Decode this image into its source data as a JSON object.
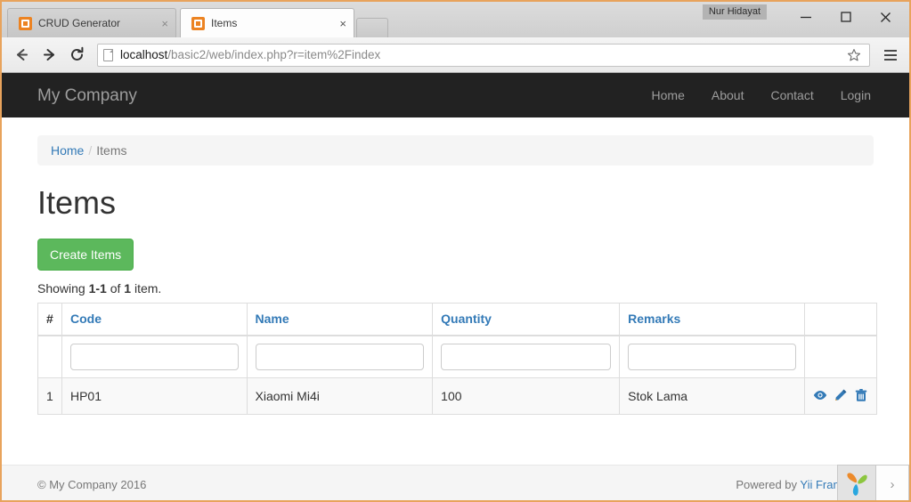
{
  "browser": {
    "user_tag": "Nur Hidayat",
    "tabs": [
      {
        "title": "CRUD Generator",
        "active": false,
        "favicon": "gii-icon",
        "close": "×"
      },
      {
        "title": "Items",
        "active": true,
        "favicon": "gii-icon",
        "close": "×"
      }
    ],
    "new_tab_label": "",
    "window_controls": {
      "minimize": "—",
      "maximize": "☐",
      "close": "✕"
    },
    "nav": {
      "back": "←",
      "forward": "→",
      "reload": "⟳"
    },
    "omnibox": {
      "url_host": "localhost",
      "url_rest": "/basic2/web/index.php?r=item%2Findex",
      "star": "☆"
    }
  },
  "site": {
    "brand": "My Company",
    "nav_links": [
      {
        "label": "Home"
      },
      {
        "label": "About"
      },
      {
        "label": "Contact"
      },
      {
        "label": "Login"
      }
    ],
    "breadcrumb": {
      "home": "Home",
      "separator": "/",
      "current": "Items"
    },
    "page_title": "Items",
    "create_button": "Create Items",
    "summary": {
      "prefix": "Showing ",
      "range": "1-1",
      "middle": " of ",
      "total": "1",
      "suffix": " item."
    },
    "grid": {
      "columns": [
        {
          "label": "#",
          "sortable": false
        },
        {
          "label": "Code",
          "sortable": true
        },
        {
          "label": "Name",
          "sortable": true
        },
        {
          "label": "Quantity",
          "sortable": true
        },
        {
          "label": "Remarks",
          "sortable": true
        },
        {
          "label": "",
          "sortable": false
        }
      ],
      "filters": [
        {
          "name": "code",
          "value": "",
          "placeholder": ""
        },
        {
          "name": "name",
          "value": "",
          "placeholder": ""
        },
        {
          "name": "quantity",
          "value": "",
          "placeholder": ""
        },
        {
          "name": "remarks",
          "value": "",
          "placeholder": ""
        }
      ],
      "rows": [
        {
          "index": "1",
          "code": "HP01",
          "name": "Xiaomi Mi4i",
          "quantity": "100",
          "remarks": "Stok Lama",
          "actions": [
            "view-icon",
            "update-icon",
            "delete-icon"
          ]
        }
      ]
    },
    "footer": {
      "copyright": "© My Company 2016",
      "powered_prefix": "Powered by ",
      "powered_link": "Yii Framework"
    }
  },
  "debug_toolbar": {
    "logo": "yii-logo-icon",
    "toggle": "›"
  },
  "colors": {
    "navbar_bg": "#222222",
    "brand_text": "#9d9d9d",
    "link_blue": "#337ab7",
    "success_green": "#5cb85c",
    "breadcrumb_bg": "#f5f5f5",
    "row_stripe": "#f9f9f9",
    "window_frame": "#e8a35c"
  }
}
